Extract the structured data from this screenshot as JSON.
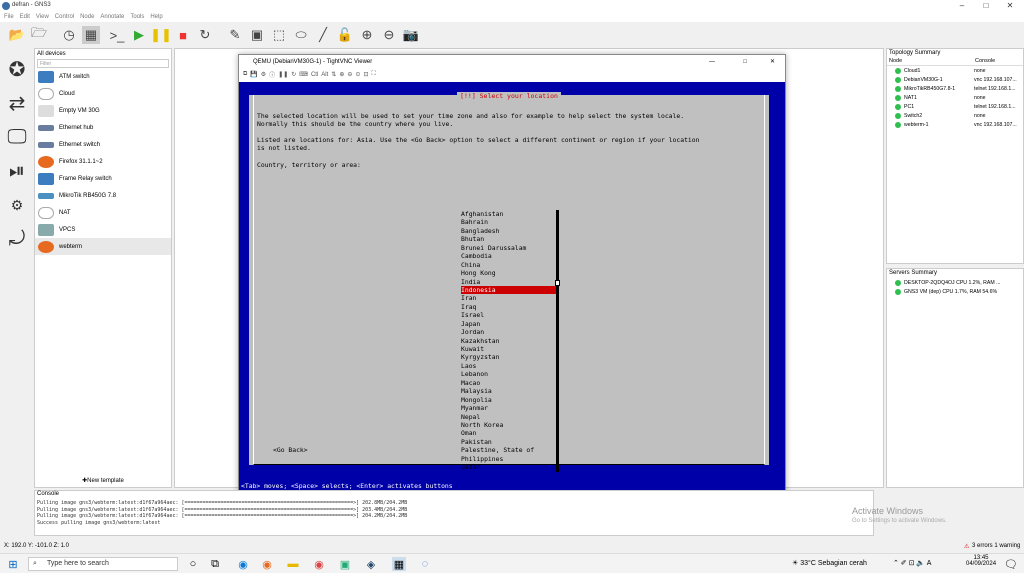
{
  "window": {
    "title": "defran - GNS3"
  },
  "menu": [
    "File",
    "Edit",
    "View",
    "Control",
    "Node",
    "Annotate",
    "Tools",
    "Help"
  ],
  "devices": {
    "header": "All devices",
    "filter_placeholder": "Filter",
    "items": [
      "ATM switch",
      "Cloud",
      "Empty VM 30G",
      "Ethernet hub",
      "Ethernet switch",
      "Firefox 31.1.1~2",
      "Frame Relay switch",
      "MikroTik RB450G 7.8",
      "NAT",
      "VPCS",
      "webterm"
    ],
    "new_template": "New template"
  },
  "vnc": {
    "title": "QEMU (DebianVM30G-1) - TightVNC Viewer",
    "dialog_title": "[!!] Select your location",
    "intro_line1": "The selected location will be used to set your time zone and also for example to help select the system locale.",
    "intro_line2": "Normally this should be the country where you live.",
    "listed_line1": "Listed are locations for: Asia. Use the <Go Back> option to select a different continent or region if your location",
    "listed_line2": "is not listed.",
    "prompt": "Country, territory or area:",
    "countries": [
      "Afghanistan",
      "Bahrain",
      "Bangladesh",
      "Bhutan",
      "Brunei Darussalam",
      "Cambodia",
      "China",
      "Hong Kong",
      "India",
      "Indonesia",
      "Iran",
      "Iraq",
      "Israel",
      "Japan",
      "Jordan",
      "Kazakhstan",
      "Kuwait",
      "Kyrgyzstan",
      "Laos",
      "Lebanon",
      "Macao",
      "Malaysia",
      "Mongolia",
      "Myanmar",
      "Nepal",
      "North Korea",
      "Oman",
      "Pakistan",
      "Palestine, State of",
      "Philippines",
      "Qatar"
    ],
    "selected": "Indonesia",
    "go_back": "<Go Back>",
    "hint": "<Tab> moves; <Space> selects; <Enter> activates buttons"
  },
  "topology": {
    "header": "Topology Summary",
    "col_node": "Node",
    "col_console": "Console",
    "rows": [
      {
        "node": "Cloud1",
        "console": "none"
      },
      {
        "node": "DebianVM30G-1",
        "console": "vnc 192.168.107..."
      },
      {
        "node": "MikroTikRB450G7.8-1",
        "console": "telnet 192.168.1..."
      },
      {
        "node": "NAT1",
        "console": "none"
      },
      {
        "node": "PC1",
        "console": "telnet 192.168.1..."
      },
      {
        "node": "Switch2",
        "console": "none"
      },
      {
        "node": "webterm-1",
        "console": "vnc 192.168.107..."
      }
    ]
  },
  "servers": {
    "header": "Servers Summary",
    "rows": [
      "DESKTOP-2QDQ4OJ CPU 1.2%, RAM ...",
      "GNS3 VM (dep) CPU 1.7%, RAM 54.6%"
    ]
  },
  "console": {
    "header": "Console",
    "lines": [
      "Pulling image gns3/webterm:latest:d1f67a964aec: [========================================================>] 202.8MB/204.2MB",
      "Pulling image gns3/webterm:latest:d1f67a964aec: [========================================================>] 203.4MB/204.2MB",
      "Pulling image gns3/webterm:latest:d1f67a964aec: [========================================================>] 204.2MB/204.2MB",
      "Success pulling image gns3/webterm:latest"
    ]
  },
  "status": {
    "coords": "X: 192.0 Y: -101.0 Z: 1.0",
    "errors": "3 errors 1 warning"
  },
  "watermark": {
    "line1": "Activate Windows",
    "line2": "Go to Settings to activate Windows."
  },
  "taskbar": {
    "search": "Type here to search",
    "weather": "33°C  Sebagian cerah",
    "time": "13:45",
    "date": "04/09/2024"
  }
}
